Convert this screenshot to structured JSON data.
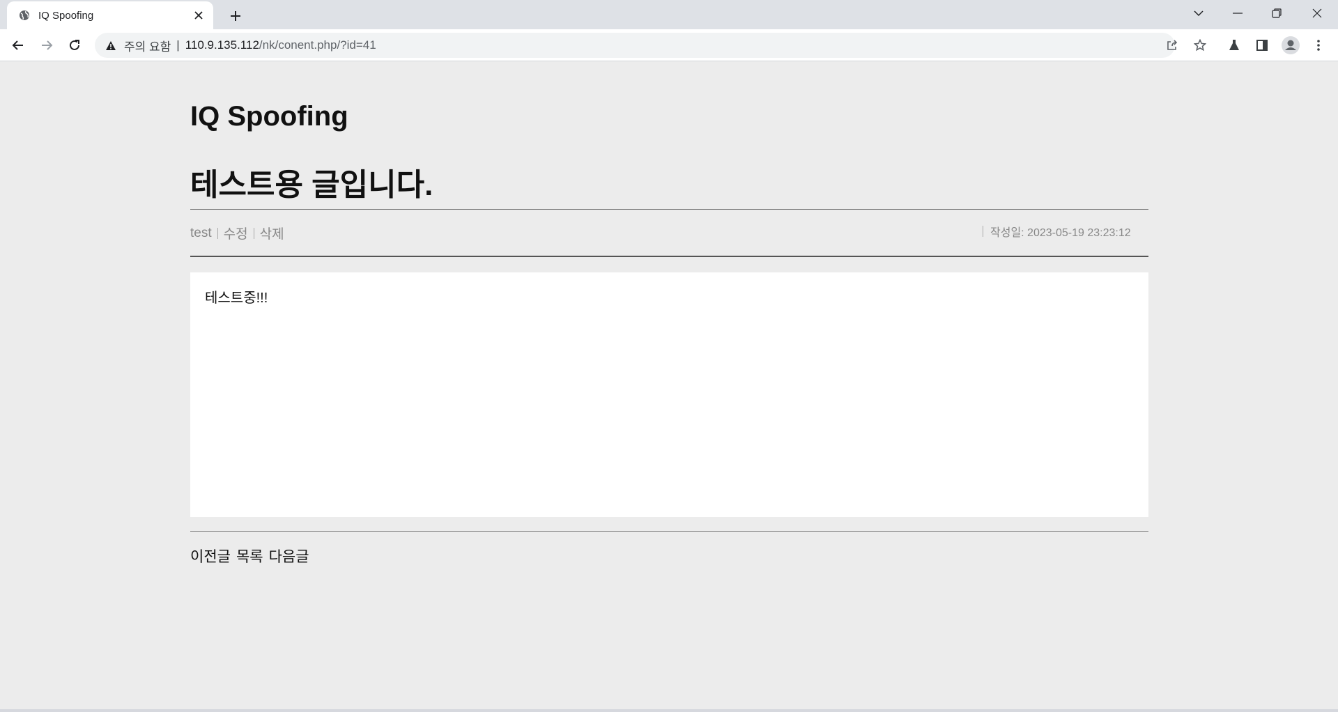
{
  "browser": {
    "tab_title": "IQ Spoofing",
    "omnibox": {
      "security_label": "주의 요함",
      "separator": "|",
      "host": "110.9.135.112",
      "path": "/nk/conent.php/?id=41"
    },
    "icons": {
      "favicon": "globe-icon",
      "close": "close-icon",
      "new_tab": "plus-icon",
      "back": "back-arrow-icon",
      "forward": "forward-arrow-icon",
      "reload": "reload-icon",
      "warning": "warning-icon",
      "share": "share-icon",
      "bookmark": "star-icon",
      "labs": "flask-icon",
      "side_panel": "side-panel-icon",
      "profile": "profile-icon",
      "menu": "kebab-menu-icon"
    }
  },
  "page": {
    "site_title": "IQ Spoofing",
    "post_title": "테스트용 글입니다.",
    "author": "test",
    "edit_label": "수정",
    "delete_label": "삭제",
    "date_label": "작성일: 2023-05-19 23:23:12",
    "content": "테스트중!!!",
    "nav": {
      "prev_label": "이전글",
      "list_label": "목록",
      "next_label": "다음글"
    }
  }
}
